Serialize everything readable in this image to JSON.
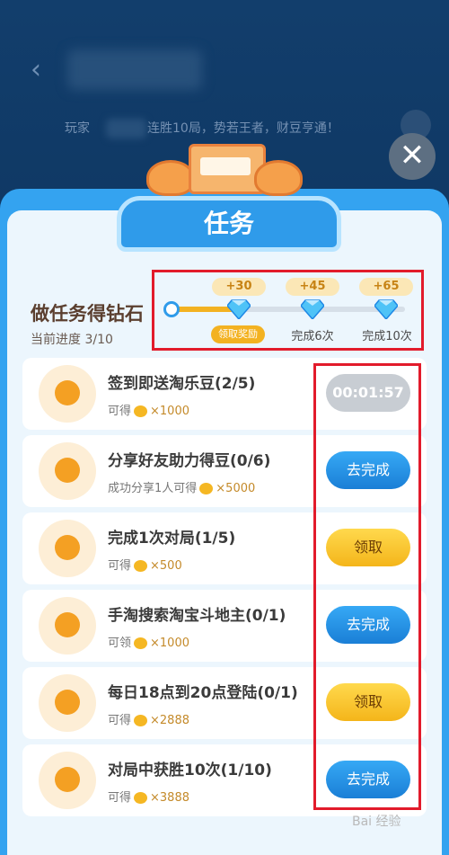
{
  "background": {
    "marquee_left": "玩家",
    "marquee_right": "连胜10局，势若王者，财豆亨通！"
  },
  "close_label": "✕",
  "modal": {
    "title": "任务",
    "diamond_section": {
      "title": "做任务得钻石",
      "progress": "当前进度 3/10",
      "progress_value": 3,
      "progress_max": 10,
      "milestones": [
        {
          "reward": "+30",
          "label": "领取奖励"
        },
        {
          "reward": "+45",
          "label": "完成6次"
        },
        {
          "reward": "+65",
          "label": "完成10次"
        }
      ]
    },
    "tasks": [
      {
        "title": "签到即送淘乐豆(2/5)",
        "reward_prefix": "可得",
        "reward_amount": "×1000",
        "button": "00:01:57",
        "icon": "orange-face-icon"
      },
      {
        "title": "分享好友助力得豆(0/6)",
        "reward_prefix": "成功分享1人可得",
        "reward_amount": "×5000",
        "button": "去完成",
        "icon": "share-icon"
      },
      {
        "title": "完成1次对局(1/5)",
        "reward_prefix": "可得",
        "reward_amount": "×500",
        "button": "领取",
        "icon": "user-icon"
      },
      {
        "title": "手淘搜索淘宝斗地主(0/1)",
        "reward_prefix": "可领",
        "reward_amount": "×1000",
        "button": "去完成",
        "icon": "eye-icon"
      },
      {
        "title": "每日18点到20点登陆(0/1)",
        "reward_prefix": "可得",
        "reward_amount": "×2888",
        "button": "领取",
        "icon": "alarm-clock-icon"
      },
      {
        "title": "对局中获胜10次(1/10)",
        "reward_prefix": "可得",
        "reward_amount": "×3888",
        "button": "去完成",
        "icon": "trophy-icon"
      }
    ]
  },
  "watermark": "Bai 经验",
  "colors": {
    "accent_blue": "#2f9bea",
    "yellow": "#f3b221",
    "highlight_red": "#e21b2b"
  }
}
